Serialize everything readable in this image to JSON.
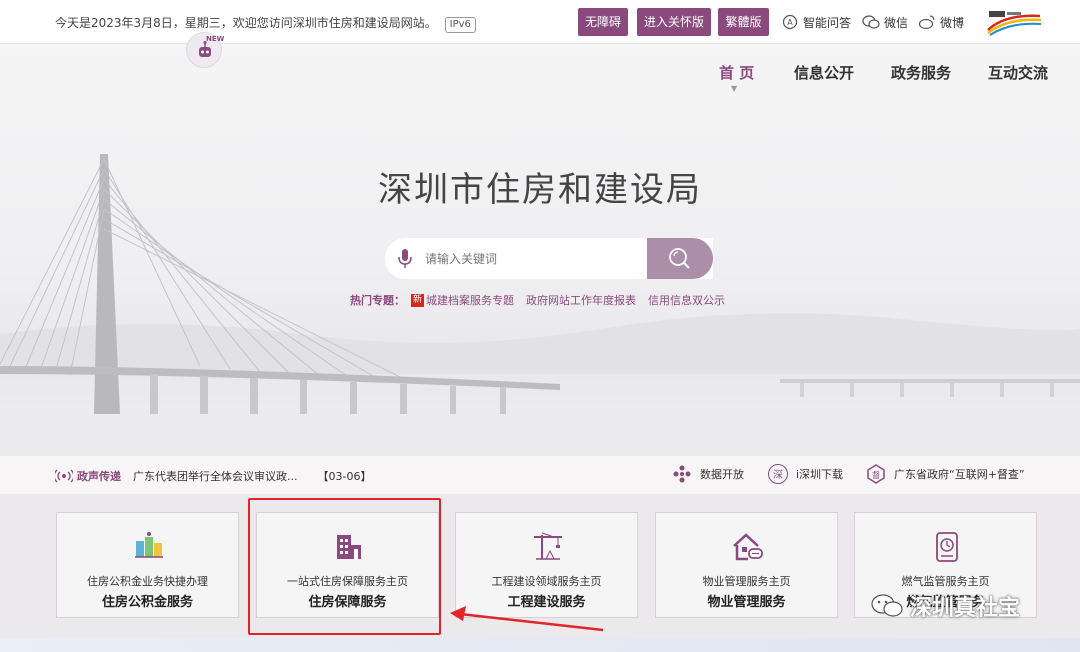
{
  "topbar": {
    "welcome": "今天是2023年3月8日，星期三，欢迎您访问深圳市住房和建设局网站。",
    "ipv6": "IPv6",
    "buttons": {
      "accessible": "无障碍",
      "elder": "进入关怀版",
      "traditional": "繁體版"
    },
    "links": {
      "ai_qa": "智能问答",
      "wechat": "微信",
      "weibo": "微博"
    }
  },
  "robot": {
    "badge": "NEW"
  },
  "nav": {
    "home": "首 页",
    "info": "信息公开",
    "gov": "政务服务",
    "interact": "互动交流"
  },
  "hero": {
    "title": "深圳市住房和建设局",
    "search_placeholder": "请输入关键词",
    "hot": {
      "label": "热门专题：",
      "new_tag": "新",
      "items": [
        "城建档案服务专题",
        "政府网站工作年度报表",
        "信用信息双公示"
      ]
    }
  },
  "strip": {
    "label": "政声传递",
    "news": "广东代表团举行全体会议审议政...",
    "date": "【03-06】",
    "links": [
      "数据开放",
      "i深圳下载",
      "广东省政府“互联网+督查”"
    ]
  },
  "cards": [
    {
      "sub": "住房公积金业务快捷办理",
      "main": "住房公积金服务",
      "icon": "provident-fund-icon"
    },
    {
      "sub": "一站式住房保障服务主页",
      "main": "住房保障服务",
      "icon": "building-icon"
    },
    {
      "sub": "工程建设领域服务主页",
      "main": "工程建设服务",
      "icon": "crane-icon"
    },
    {
      "sub": "物业管理服务主页",
      "main": "物业管理服务",
      "icon": "house-chat-icon"
    },
    {
      "sub": "燃气监管服务主页",
      "main": "燃气监管服务",
      "icon": "gas-meter-icon"
    }
  ],
  "watermark": "深圳真社宝",
  "colors": {
    "brand": "#8a4a7e",
    "highlight": "#e0262a",
    "search_button": "#ab8fa8"
  }
}
